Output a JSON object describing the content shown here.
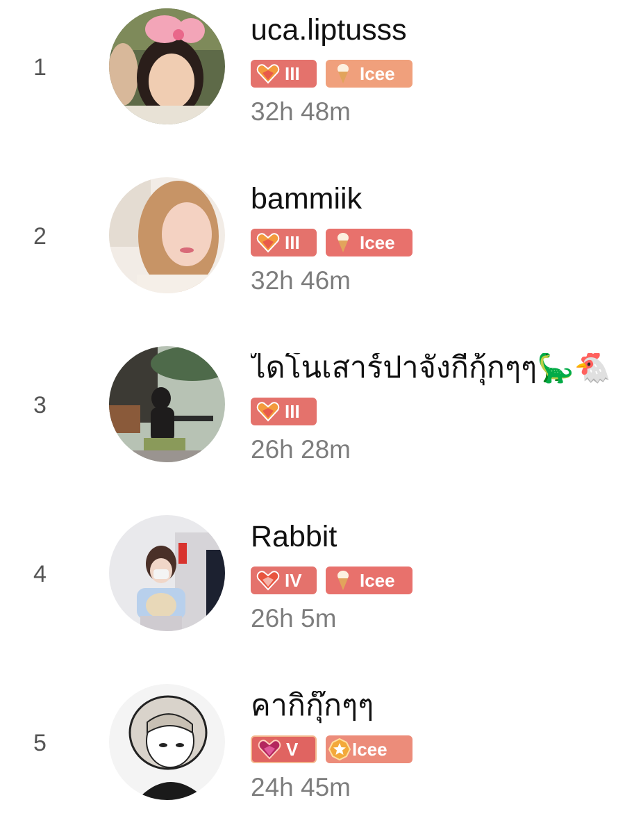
{
  "leaderboard": [
    {
      "rank": "1",
      "name": "uca.liptusss",
      "level_badge": "III",
      "fan_badge": "Icee",
      "watch_time": "32h 48m"
    },
    {
      "rank": "2",
      "name": "bammiik",
      "level_badge": "III",
      "fan_badge": "Icee",
      "watch_time": "32h 46m"
    },
    {
      "rank": "3",
      "name": "ไดโนเสาร์ปาจังกี้กุ้กๆๆ🦕🐔",
      "level_badge": "III",
      "watch_time": "26h 28m"
    },
    {
      "rank": "4",
      "name": "Rabbit",
      "level_badge": "IV",
      "fan_badge": "Icee",
      "watch_time": "26h 5m"
    },
    {
      "rank": "5",
      "name": "คากิกุ๊กๆๆ",
      "level_badge": "V",
      "fan_badge": "Icee",
      "watch_time": "24h 45m"
    }
  ],
  "icons": {
    "level": "heart-gem-icon",
    "fan": "ice-cream-icon",
    "fan_top": "star-medal-icon"
  },
  "colors": {
    "level_badge": "#e4726c",
    "fan_badge": "#e8716c",
    "fan_badge_peach": "#f0a07c",
    "time_text": "#7d7d7d",
    "rank_text": "#555555"
  }
}
